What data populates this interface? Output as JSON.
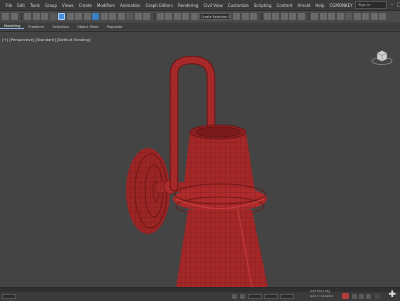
{
  "menu": {
    "items": [
      "File",
      "Edit",
      "Tools",
      "Group",
      "Views",
      "Create",
      "Modifiers",
      "Animation",
      "Graph Editors",
      "Rendering",
      "Civil View",
      "Customize",
      "Scripting",
      "Content",
      "Arnold",
      "Help",
      "CGMONKEY"
    ],
    "sign_in": "Sign In"
  },
  "toolbar": {
    "selection_filter": "Create Selection Set"
  },
  "ribbon": {
    "tabs": [
      "Modeling",
      "Freeform",
      "Selection",
      "Object Paint",
      "Populate"
    ]
  },
  "viewport": {
    "label": "[+] [Perspective] [Standard] [Default Shading]"
  },
  "status": {
    "add_time_tag": "Add Time Tag",
    "grid": "Grid = 10.0mm"
  }
}
